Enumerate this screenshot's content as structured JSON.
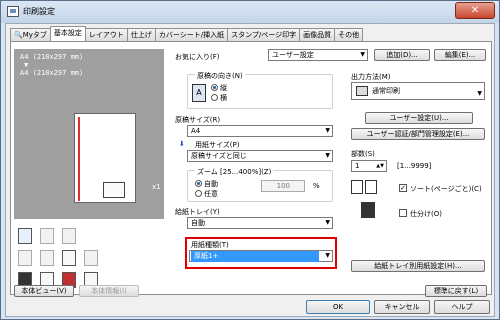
{
  "window": {
    "title": "印刷設定"
  },
  "tabs": [
    {
      "label": "Myタブ"
    },
    {
      "label": "基本設定"
    },
    {
      "label": "レイアウト"
    },
    {
      "label": "仕上げ"
    },
    {
      "label": "カバーシート/挿入紙"
    },
    {
      "label": "スタンプ/ページ印字"
    },
    {
      "label": "画像品質"
    },
    {
      "label": "その他"
    }
  ],
  "preview": {
    "line1": "A4 (210x297 mm)",
    "arrow": "▼",
    "line2": "A4 (210x297 mm)",
    "copies": "x1"
  },
  "preview_buttons": {
    "body_view": "本体ビュー(V)",
    "body_info": "本体情報(I)"
  },
  "favorites": {
    "label": "お気に入り(F)",
    "value": "ユーザー設定",
    "add": "追加(D)...",
    "edit": "編集(E)..."
  },
  "orientation": {
    "label": "原稿の向き(N)",
    "portrait": "縦",
    "landscape": "横"
  },
  "original_size": {
    "label": "原稿サイズ(R)",
    "value": "A4"
  },
  "paper_size": {
    "label": "用紙サイズ(P)",
    "value": "原稿サイズと同じ"
  },
  "zoom": {
    "label": "ズーム [25...400%](Z)",
    "auto": "自動",
    "manual": "任意",
    "value": "100",
    "unit": "%"
  },
  "tray": {
    "label": "給紙トレイ(Y)",
    "value": "自動"
  },
  "paper_type": {
    "label": "用紙種類(T)",
    "value": "厚紙1+"
  },
  "output": {
    "label": "出力方法(M)",
    "value": "通常印刷",
    "user_settings": "ユーザー設定(U)...",
    "auth": "ユーザー認証/部門管理設定(E)..."
  },
  "copies": {
    "label": "部数(S)",
    "value": "1",
    "range": "[1...9999]",
    "collate": "ソート(ページごと)(C)",
    "offset": "仕分け(O)"
  },
  "tray_paper_btn": "給紙トレイ別用紙設定(H)...",
  "reset_btn": "標準に戻す(L)",
  "footer": {
    "ok": "OK",
    "cancel": "キャンセル",
    "help": "ヘルプ"
  }
}
